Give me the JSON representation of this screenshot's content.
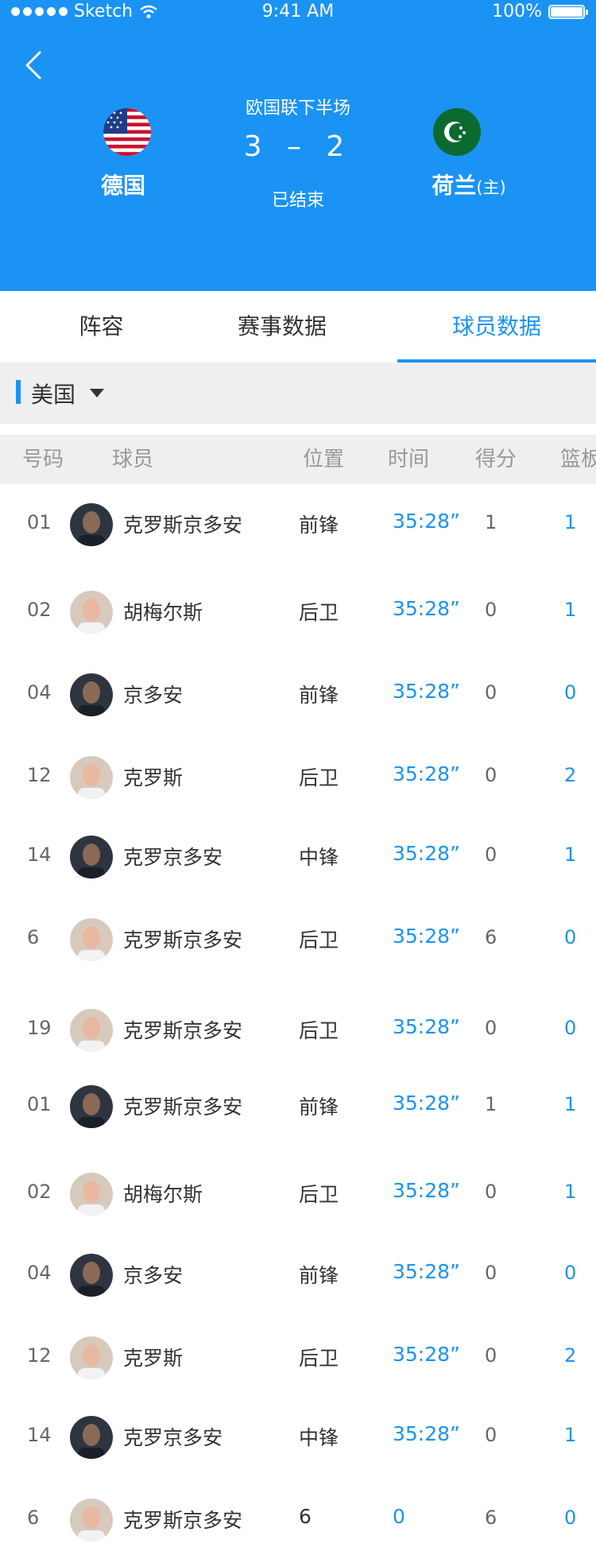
{
  "status_bar": {
    "carrier": "Sketch",
    "time": "9:41 AM",
    "battery": "100%",
    "battery_level": 1.0
  },
  "match": {
    "period": "欧国联下半场",
    "score": "3 – 2",
    "status": "已结束",
    "home": {
      "name": "德国",
      "flag_icon": "us-flag-icon"
    },
    "away": {
      "name": "荷兰",
      "host_tag": "(主)",
      "flag_icon": "crescent-flag-icon"
    }
  },
  "tabs": [
    {
      "label": "阵容",
      "active": false
    },
    {
      "label": "赛事数据",
      "active": false
    },
    {
      "label": "球员数据",
      "active": true
    }
  ],
  "filter": {
    "team_label": "美国"
  },
  "table": {
    "headers": [
      "号码",
      "球员",
      "位置",
      "时间",
      "得分",
      "篮板"
    ],
    "rows": [
      {
        "number": "01",
        "name": "克罗斯京多安",
        "position": "前锋",
        "time": "35:28”",
        "score": "1",
        "extra": "1",
        "avatar": "dark"
      },
      {
        "number": "02",
        "name": "胡梅尔斯",
        "position": "后卫",
        "time": "35:28”",
        "score": "0",
        "extra": "1",
        "avatar": "light"
      },
      {
        "number": "04",
        "name": "京多安",
        "position": "前锋",
        "time": "35:28”",
        "score": "0",
        "extra": "0",
        "avatar": "dark"
      },
      {
        "number": "12",
        "name": "克罗斯",
        "position": "后卫",
        "time": "35:28”",
        "score": "0",
        "extra": "2",
        "avatar": "light"
      },
      {
        "number": "14",
        "name": "克罗京多安",
        "position": "中锋",
        "time": "35:28”",
        "score": "0",
        "extra": "1",
        "avatar": "dark"
      },
      {
        "number": "6",
        "name": "克罗斯京多安",
        "position": "后卫",
        "time": "35:28”",
        "score": "6",
        "extra": "0",
        "avatar": "light"
      },
      {
        "number": "19",
        "name": "克罗斯京多安",
        "position": "后卫",
        "time": "35:28”",
        "score": "0",
        "extra": "0",
        "avatar": "light"
      },
      {
        "number": "01",
        "name": "克罗斯京多安",
        "position": "前锋",
        "time": "35:28”",
        "score": "1",
        "extra": "1",
        "avatar": "dark"
      },
      {
        "number": "02",
        "name": "胡梅尔斯",
        "position": "后卫",
        "time": "35:28”",
        "score": "0",
        "extra": "1",
        "avatar": "light"
      },
      {
        "number": "04",
        "name": "京多安",
        "position": "前锋",
        "time": "35:28”",
        "score": "0",
        "extra": "0",
        "avatar": "dark"
      },
      {
        "number": "12",
        "name": "克罗斯",
        "position": "后卫",
        "time": "35:28”",
        "score": "0",
        "extra": "2",
        "avatar": "light"
      },
      {
        "number": "14",
        "name": "克罗京多安",
        "position": "中锋",
        "time": "35:28”",
        "score": "0",
        "extra": "1",
        "avatar": "dark"
      },
      {
        "number": "6",
        "name": "克罗斯京多安",
        "position": "6",
        "time": "0",
        "score": "6",
        "extra": "0",
        "avatar": "light"
      }
    ]
  },
  "colors": {
    "primary": "#1a93f5",
    "header_bg": "#1a93f5",
    "filter_bg": "#efefef",
    "text_dark": "#333333",
    "text_muted": "#999999"
  }
}
